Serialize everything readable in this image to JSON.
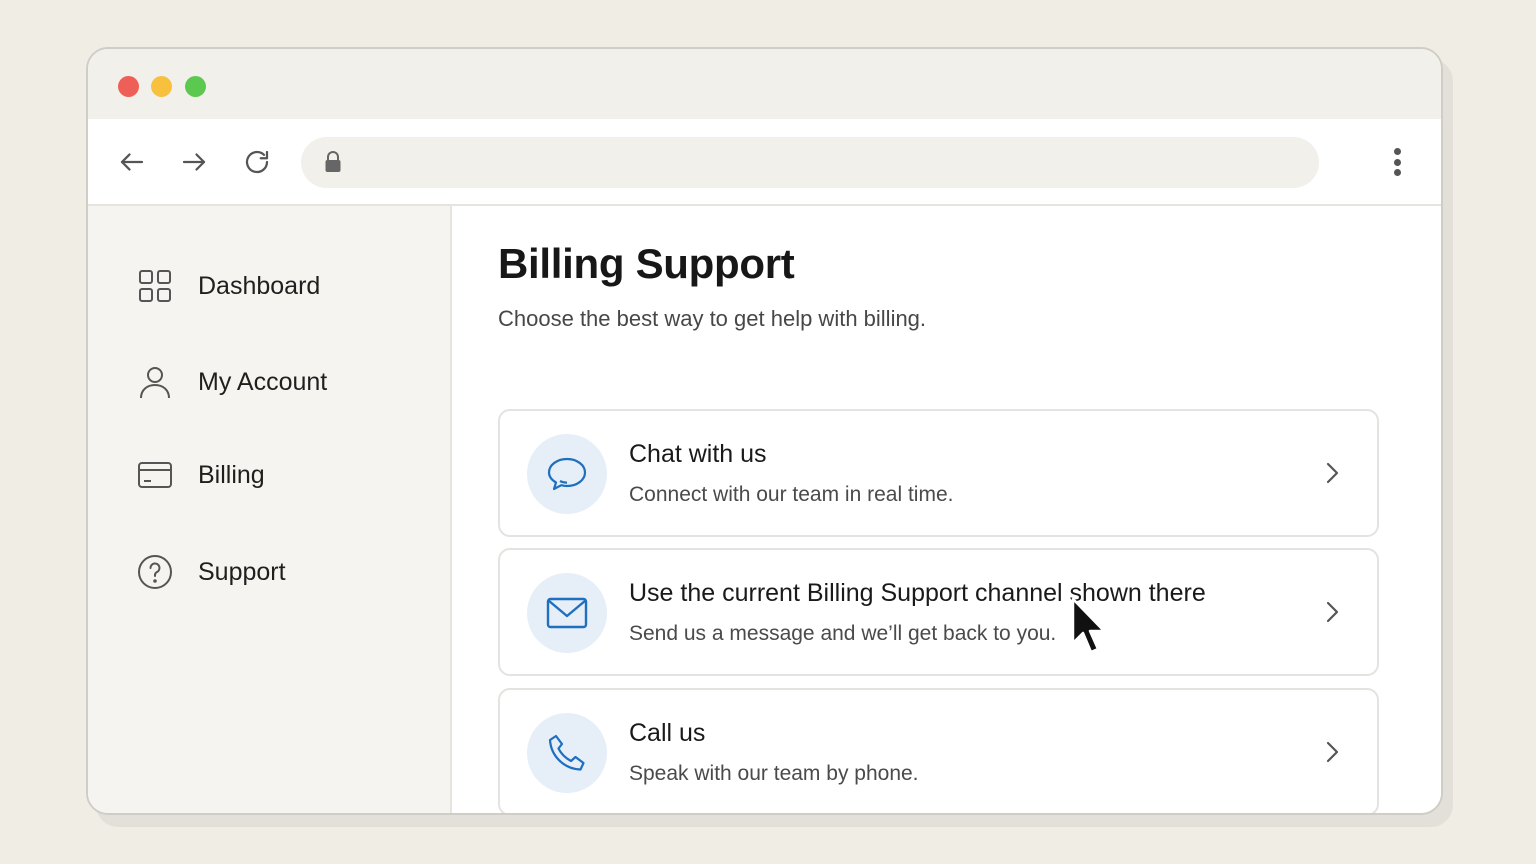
{
  "window": {
    "traffic_lights": [
      "close",
      "minimize",
      "maximize"
    ],
    "colors": {
      "close": "#ee5f57",
      "minimize": "#f7c13d",
      "maximize": "#5bc84f"
    }
  },
  "toolbar": {
    "back_icon": "arrow-left-icon",
    "forward_icon": "arrow-right-icon",
    "reload_icon": "reload-icon",
    "lock_icon": "lock-icon",
    "url_value": "",
    "menu_icon": "vertical-dots-icon"
  },
  "sidebar": {
    "items": [
      {
        "label": "Dashboard",
        "icon": "grid-icon"
      },
      {
        "label": "My Account",
        "icon": "user-icon"
      },
      {
        "label": "Billing",
        "icon": "credit-card-icon"
      },
      {
        "label": "Support",
        "icon": "help-circle-icon"
      }
    ]
  },
  "main": {
    "title": "Billing Support",
    "subtitle": "Choose the best way to get help with billing.",
    "options": [
      {
        "title": "Chat with us",
        "description": "Connect with our team in real time.",
        "icon": "chat-bubble-icon"
      },
      {
        "title": "Use the current Billing Support channel shown there",
        "description": "Send us a message and we’ll get back to you.",
        "icon": "mail-icon"
      },
      {
        "title": "Call us",
        "description": "Speak with our team by phone.",
        "icon": "phone-icon"
      }
    ]
  },
  "accent_color": "#1f6fbf",
  "icon_bg_color": "#e6eef8"
}
